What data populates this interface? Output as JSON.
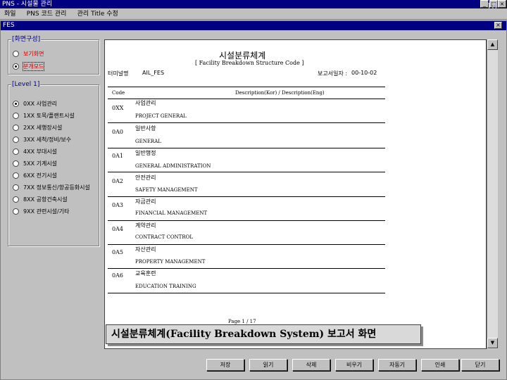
{
  "app": {
    "title": "PNS - 시설물 관리",
    "slide_number": "18"
  },
  "menu": [
    "화일",
    "PNS 코드 관리",
    "관리 Title 수정"
  ],
  "child_window": {
    "title": "FES"
  },
  "screen_group": {
    "label": "[화면구성]",
    "options": [
      {
        "label": "보기화면",
        "selected": false
      },
      {
        "label": "분개모드",
        "selected": true
      }
    ]
  },
  "level_group": {
    "label": "[Level 1]",
    "options": [
      {
        "label": "0XX 사업관리",
        "selected": true
      },
      {
        "label": "1XX 토목/플랜트시설",
        "selected": false
      },
      {
        "label": "2XX 세행장시설",
        "selected": false
      },
      {
        "label": "3XX 세척/정비/보수",
        "selected": false
      },
      {
        "label": "4XX 부대시설",
        "selected": false
      },
      {
        "label": "5XX 기계시설",
        "selected": false
      },
      {
        "label": "6XX 전기시설",
        "selected": false
      },
      {
        "label": "7XX 정보통신/항공등화시설",
        "selected": false
      },
      {
        "label": "8XX 공항건축시설",
        "selected": false
      },
      {
        "label": "9XX 관련시설/기타",
        "selected": false
      }
    ]
  },
  "report": {
    "title": "시설분류체계",
    "subtitle": "[ Facility Breakdown Structure Code ]",
    "terminal_label": "터미널명",
    "terminal_value": "AIL_FES",
    "date_label": "보고서일자 :",
    "date_value": "00-10-02",
    "col_code": "Code",
    "col_desc": "Description(Kor) / Description(Eng)",
    "rows": [
      {
        "code": "0XX",
        "kor": "사업관리",
        "eng": "PROJECT GENERAL"
      },
      {
        "code": "0A0",
        "kor": "일반사항",
        "eng": "GENERAL"
      },
      {
        "code": "0A1",
        "kor": "일반행정",
        "eng": "GENERAL ADMINISTRATION"
      },
      {
        "code": "0A2",
        "kor": "안전관리",
        "eng": "SAFETY MANAGEMENT"
      },
      {
        "code": "0A3",
        "kor": "자금관리",
        "eng": "FINANCIAL MANAGEMENT"
      },
      {
        "code": "0A4",
        "kor": "계약관리",
        "eng": "CONTRACT CONTROL"
      },
      {
        "code": "0A5",
        "kor": "자산관리",
        "eng": "PROPERTY MANAGEMENT"
      },
      {
        "code": "0A6",
        "kor": "교육훈련",
        "eng": "EDUCATION TRAINING"
      }
    ],
    "page": "Page 1 / 17"
  },
  "caption": "시설분류체계(Facility Breakdown System) 보고서 화면",
  "buttons": [
    "저장",
    "읽기",
    "삭제",
    "비우기",
    "자동기",
    "인쇄",
    "닫기"
  ]
}
